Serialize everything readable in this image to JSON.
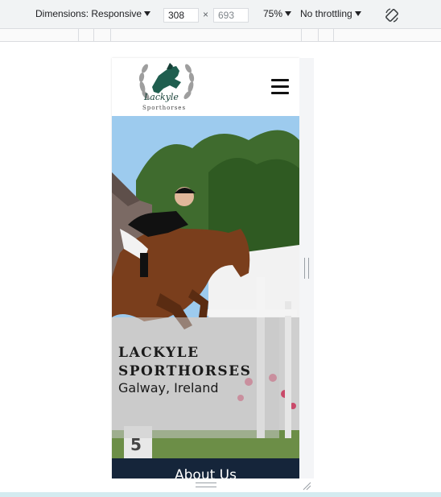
{
  "toolbar": {
    "dimensions_label": "Dimensions: Responsive",
    "width_value": "308",
    "height_value": "693",
    "times": "×",
    "zoom_label": "75%",
    "throttling_label": "No throttling",
    "rotate_icon": "rotate-icon"
  },
  "site": {
    "logo_icon": "laurel-horse-logo",
    "logo_script": "Lackyle",
    "logo_caption": "Sporthorses",
    "menu_icon": "hamburger-menu-icon",
    "hero_title": "LACKYLE SPORTHORSES",
    "hero_subtitle": "Galway, Ireland",
    "fence_number": "5",
    "section_heading": "About Us"
  },
  "colors": {
    "header_bg": "#ffffff",
    "about_bar": "#15253a",
    "logo_green": "#1f5e4f"
  }
}
